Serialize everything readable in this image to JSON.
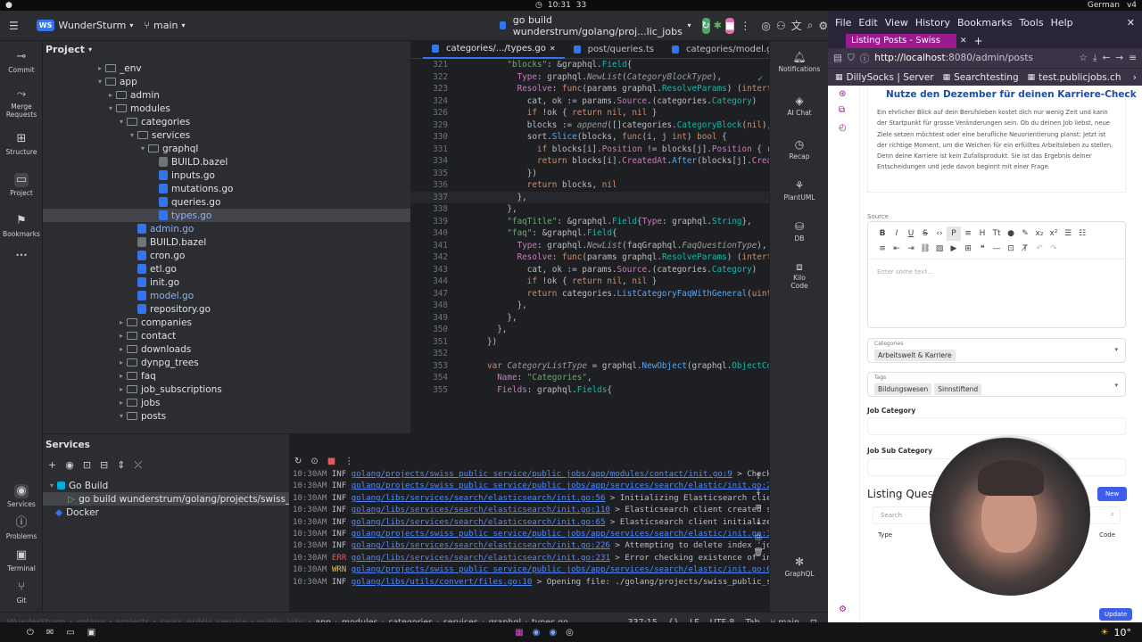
{
  "topbar": {
    "time": "10:31",
    "count": "33",
    "lang": "German",
    "layout": "v4"
  },
  "ide": {
    "workspace_badge": "WS",
    "workspace": "WunderSturm",
    "branch": "main",
    "run_config": "go build wunderstrum/golang/proj...lic_jobs",
    "left_strip": [
      "Commit",
      "Merge Requests",
      "Structure",
      "Project",
      "Bookmarks"
    ],
    "left_strip_bottom": [
      "Services",
      "Problems",
      "Terminal",
      "Git"
    ],
    "right_strip": [
      "Notifications",
      "AI Chat",
      "Recap",
      "PlantUML",
      "DB",
      "Kilo Code",
      "GraphQL"
    ],
    "project_title": "Project",
    "tree": [
      {
        "label": "_env",
        "kind": "folder",
        "depth": 5,
        "open": false
      },
      {
        "label": "app",
        "kind": "folder",
        "depth": 5,
        "open": true
      },
      {
        "label": "admin",
        "kind": "folder",
        "depth": 6,
        "open": false
      },
      {
        "label": "modules",
        "kind": "folder",
        "depth": 6,
        "open": true
      },
      {
        "label": "categories",
        "kind": "folder",
        "depth": 7,
        "open": true
      },
      {
        "label": "services",
        "kind": "folder",
        "depth": 8,
        "open": true
      },
      {
        "label": "graphql",
        "kind": "folder",
        "depth": 9,
        "open": true
      },
      {
        "label": "BUILD.bazel",
        "kind": "bazel",
        "depth": 10
      },
      {
        "label": "inputs.go",
        "kind": "go",
        "depth": 10
      },
      {
        "label": "mutations.go",
        "kind": "go",
        "depth": 10
      },
      {
        "label": "queries.go",
        "kind": "go",
        "depth": 10
      },
      {
        "label": "types.go",
        "kind": "go",
        "depth": 10,
        "selected": true,
        "blue": true
      },
      {
        "label": "admin.go",
        "kind": "go",
        "depth": 8,
        "blue": true
      },
      {
        "label": "BUILD.bazel",
        "kind": "bazel",
        "depth": 8
      },
      {
        "label": "cron.go",
        "kind": "go",
        "depth": 8
      },
      {
        "label": "etl.go",
        "kind": "go",
        "depth": 8
      },
      {
        "label": "init.go",
        "kind": "go",
        "depth": 8
      },
      {
        "label": "model.go",
        "kind": "go",
        "depth": 8,
        "blue": true
      },
      {
        "label": "repository.go",
        "kind": "go",
        "depth": 8
      },
      {
        "label": "companies",
        "kind": "folder",
        "depth": 7,
        "open": false
      },
      {
        "label": "contact",
        "kind": "folder",
        "depth": 7,
        "open": false
      },
      {
        "label": "downloads",
        "kind": "folder",
        "depth": 7,
        "open": false
      },
      {
        "label": "dynpg_trees",
        "kind": "folder",
        "depth": 7,
        "open": false
      },
      {
        "label": "faq",
        "kind": "folder",
        "depth": 7,
        "open": false
      },
      {
        "label": "job_subscriptions",
        "kind": "folder",
        "depth": 7,
        "open": false
      },
      {
        "label": "jobs",
        "kind": "folder",
        "depth": 7,
        "open": false
      },
      {
        "label": "posts",
        "kind": "folder",
        "depth": 7,
        "open": true
      }
    ],
    "editor_tabs": [
      {
        "label": "categories/.../types.go",
        "active": true
      },
      {
        "label": "post/queries.ts",
        "active": false
      },
      {
        "label": "categories/model.go",
        "active": false
      }
    ],
    "code": [
      {
        "n": "321",
        "html": "\t\t<span class='s'>\"blocks\"</span>: &amp;graphql.<span class='t'>Field</span>{"
      },
      {
        "n": "322",
        "html": "\t\t\t<span class='p'>Type</span>: graphql.<span class='i'>NewList</span>(<span class='i'>CategoryBlockType</span>),"
      },
      {
        "n": "323",
        "html": "\t\t\t<span class='p'>Resolve</span>: <span class='k'>func</span>(params graphql.<span class='t'>ResolveParams</span>) (<span class='k'>interface</span>{}, e"
      },
      {
        "n": "324",
        "html": "\t\t\t\tcat, ok := params.<span class='p'>Source</span>.(categories.<span class='t'>Category</span>)"
      },
      {
        "n": "326",
        "html": "\t\t\t\t<span class='k'>if</span> !ok { <span class='k'>return</span> <span class='k'>nil</span>, <span class='k'>nil</span> }"
      },
      {
        "n": "329",
        "html": "\t\t\t\tblocks := <span class='i'>append</span>([]categories.<span class='t'>CategoryBlock</span>(<span class='k'>nil</span>), cat.B"
      },
      {
        "n": "330",
        "html": "\t\t\t\tsort.<span class='f'>Slice</span>(blocks, <span class='k'>func</span>(i, j <span class='k'>int</span>) <span class='k'>bool</span> {"
      },
      {
        "n": "331",
        "html": "\t\t\t\t\t<span class='k'>if</span> blocks[i].<span class='p'>Position</span> != blocks[j].<span class='p'>Position</span> { <span class='k'>retur</span>"
      },
      {
        "n": "334",
        "html": "\t\t\t\t\t<span class='k'>return</span> blocks[i].<span class='p'>CreatedAt</span>.<span class='f'>After</span>(blocks[j].<span class='p'>CreatedA</span>"
      },
      {
        "n": "335",
        "html": "\t\t\t\t})"
      },
      {
        "n": "336",
        "html": "\t\t\t\t<span class='k'>return</span> blocks, <span class='k'>nil</span>"
      },
      {
        "n": "337",
        "html": "\t\t\t},"
      },
      {
        "n": "338",
        "html": "\t\t},"
      },
      {
        "n": "339",
        "html": "\t\t<span class='s'>\"faqTitle\"</span>: &amp;graphql.<span class='t'>Field</span>{<span class='p'>Type</span>: graphql.<span class='t'>String</span>},"
      },
      {
        "n": "340",
        "html": "\t\t<span class='s'>\"faq\"</span>: &amp;graphql.<span class='t'>Field</span>{"
      },
      {
        "n": "341",
        "html": "\t\t\t<span class='p'>Type</span>: graphql.<span class='i'>NewList</span>(faqGraphql.<span class='i'>FaqQuestionType</span>),"
      },
      {
        "n": "342",
        "html": "\t\t\t<span class='p'>Resolve</span>: <span class='k'>func</span>(params graphql.<span class='t'>ResolveParams</span>) (<span class='k'>interface</span>{}, e"
      },
      {
        "n": "343",
        "html": "\t\t\t\tcat, ok := params.<span class='p'>Source</span>.(categories.<span class='t'>Category</span>)"
      },
      {
        "n": "344",
        "html": "\t\t\t\t<span class='k'>if</span> !ok { <span class='k'>return</span> <span class='k'>nil</span>, <span class='k'>nil</span> }"
      },
      {
        "n": "347",
        "html": "\t\t\t\t<span class='k'>return</span> categories.<span class='f'>ListCategoryFaqWithGeneral</span>(<span class='k'>uint</span>(cat.I"
      },
      {
        "n": "348",
        "html": "\t\t\t},"
      },
      {
        "n": "349",
        "html": "\t\t},"
      },
      {
        "n": "350",
        "html": "\t},"
      },
      {
        "n": "351",
        "html": "})"
      },
      {
        "n": "352",
        "html": ""
      },
      {
        "n": "353",
        "html": "<span class='k'>var</span> <span class='i'>CategoryListType</span> = graphql.<span class='f'>NewObject</span>(graphql.<span class='t'>ObjectConfig</span>{"
      },
      {
        "n": "354",
        "html": "\t<span class='p'>Name</span>: <span class='s'>\"Categories\"</span>,"
      },
      {
        "n": "355",
        "html": "\t<span class='p'>Fields</span>: graphql.<span class='t'>Fields</span>{"
      }
    ],
    "services_title": "Services",
    "services_tree": [
      "Go Build",
      "go build wunderstrum/golang/projects/swiss_public_se",
      "Docker"
    ],
    "logs": [
      {
        "time": "10:30AM",
        "lvl": "INF",
        "path": "golang/projects/swiss_public_service/public_jobs/app/modules/contact/init.go:9",
        "msg": " > Check in"
      },
      {
        "time": "10:30AM",
        "lvl": "INF",
        "path": "golang/projects/swiss_public_service/public_jobs/app/services/search/elastic/init.go:29",
        "msg": " > Initializing"
      },
      {
        "time": "10:30AM",
        "lvl": "INF",
        "path": "golang/libs/services/search/elasticsearch/init.go:56",
        "msg": " > Initializing Elasticsearch client w"
      },
      {
        "time": "10:30AM",
        "lvl": "INF",
        "path": "golang/libs/services/search/elasticsearch/init.go:110",
        "msg": " > Elasticsearch client created succe"
      },
      {
        "time": "10:30AM",
        "lvl": "INF",
        "path": "golang/libs/services/search/elasticsearch/init.go:65",
        "msg": " > Elasticsearch client initialized su"
      },
      {
        "time": "10:30AM",
        "lvl": "INF",
        "path": "golang/projects/swiss_public_service/public_jobs/app/services/search/elastic/init.go:37",
        "msg": " > Setting up"
      },
      {
        "time": "10:30AM",
        "lvl": "INF",
        "path": "golang/libs/services/search/elasticsearch/init.go:226",
        "msg": " > Attempting to delete index 'jobs'."
      },
      {
        "time": "10:30AM",
        "lvl": "ERR",
        "path": "golang/libs/services/search/elasticsearch/init.go:231",
        "msg": " > Error checking existence of index"
      },
      {
        "time": "10:30AM",
        "lvl": "WRN",
        "path": "golang/projects/swiss_public_service/public_jobs/app/services/search/elastic/init.go:61",
        "msg": " > Search ind"
      },
      {
        "time": "10:30AM",
        "lvl": "INF",
        "path": "golang/libs/utils/convert/files.go:10",
        "msg": " > Opening file: ./golang/projects/swiss_public_servi"
      }
    ],
    "breadcrumbs": [
      "WunderSturm",
      "golang",
      "projects",
      "swiss_public_service",
      "public_jobs",
      "app",
      "modules",
      "categories",
      "services",
      "graphql",
      "types.go"
    ],
    "status": {
      "pos": "337:15",
      "eol": "LF",
      "enc": "UTF-8",
      "indent": "Tab",
      "branch": "main"
    }
  },
  "browser": {
    "menu": [
      "File",
      "Edit",
      "View",
      "History",
      "Bookmarks",
      "Tools",
      "Help"
    ],
    "tab_title": "Listing Posts - Swiss",
    "url_host": "http://localhost",
    "url_rest": ":8080/admin/posts",
    "bookmarks": [
      "DillySocks | Server",
      "Searchtesting",
      "test.publicjobs.ch"
    ],
    "post_title": "Nutze den Dezember für deinen Karriere-Check",
    "post_body": "Ein ehrlicher Blick auf dein Berufsleben kostet dich nur wenig Zeit und kann der Startpunkt für grosse Veränderungen sein. Ob du deinen Job liebst, neue Ziele setzen möchtest oder eine berufliche Neuorientierung planst: Jetzt ist der richtige Moment, um die Weichen für ein erfülltes Arbeitsleben zu stellen. Denn deine Karriere ist kein Zufallsprodukt. Sie ist das Ergebnis deiner Entscheidungen und jede davon beginnt mit einer Frage.",
    "source_label": "Source",
    "editor_placeholder": "Enter some text...",
    "categories_label": "Categories",
    "categories": [
      "Arbeitswelt & Karriere"
    ],
    "tags_label": "Tags",
    "tags": [
      "Bildungswesen",
      "Sinnstiftend"
    ],
    "job_category_label": "Job Category",
    "job_sub_category_label": "Job Sub Category",
    "listing_title": "Listing Questi",
    "new_button": "New",
    "search_placeholder": "Search",
    "col_type": "Type",
    "col_code": "Code",
    "update_button": "Update"
  },
  "taskbar": {
    "temp": "10°"
  }
}
